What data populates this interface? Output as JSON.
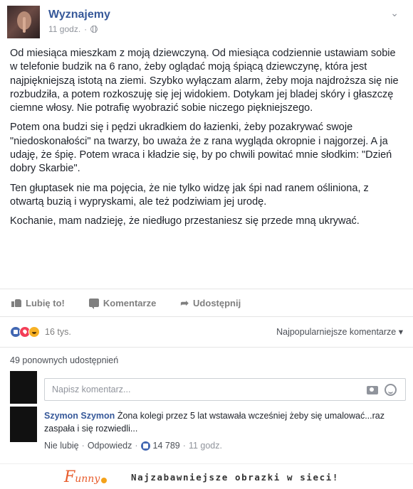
{
  "post": {
    "page_name": "Wyznajemy",
    "time": "11 godz.",
    "paragraphs": [
      "Od miesiąca mieszkam z moją dziewczyną. Od miesiąca codziennie ustawiam sobie w telefonie budzik na 6 rano, żeby oglądać moją śpiącą dziewczynę, która jest najpiękniejszą istotą na ziemi. Szybko wyłączam alarm, żeby moja najdroższa się nie rozbudziła, a potem rozkoszuję się jej widokiem. Dotykam jej bladej skóry i głaszczę ciemne włosy. Nie potrafię wyobrazić sobie niczego piękniejszego.",
      "Potem ona budzi się i pędzi ukradkiem do łazienki, żeby pozakrywać swoje \"niedoskonałości\" na twarzy, bo uważa że z rana wygląda okropnie i najgorzej. A ja udaję, że śpię. Potem wraca i kładzie się, by po chwili powitać mnie słodkim: \"Dzień dobry Skarbie\".",
      "Ten głuptasek nie ma pojęcia, że nie tylko widzę jak śpi nad ranem ośliniona, z otwartą buzią i wypryskami, ale też podziwiam jej urodę.",
      "Kochanie, mam nadzieję, że niedługo przestaniesz się przede mną ukrywać."
    ]
  },
  "actions": {
    "like": "Lubię to!",
    "comment": "Komentarze",
    "share": "Udostępnij"
  },
  "reactions": {
    "count": "16 tys.",
    "sort": "Najpopularniejsze komentarze ▾"
  },
  "shares": "49 ponownych udostępnień",
  "comment_input": {
    "placeholder": "Napisz komentarz..."
  },
  "comment": {
    "author": "Szymon Szymon",
    "text": "Żona kolegi przez 5 lat wstawała wcześniej żeby się umalować...raz zaspała i się rozwiedli...",
    "unlike": "Nie lubię",
    "reply": "Odpowiedz",
    "likes": "14 789",
    "time": "11 godz."
  },
  "footer": {
    "logo_f": "F",
    "logo_rest": "unny",
    "tagline": "Najzabawniejsze obrazki w sieci!"
  },
  "icons": [
    "globe-icon",
    "chevron-down-icon",
    "like-icon",
    "comment-icon",
    "share-icon",
    "camera-icon",
    "emoji-icon"
  ]
}
